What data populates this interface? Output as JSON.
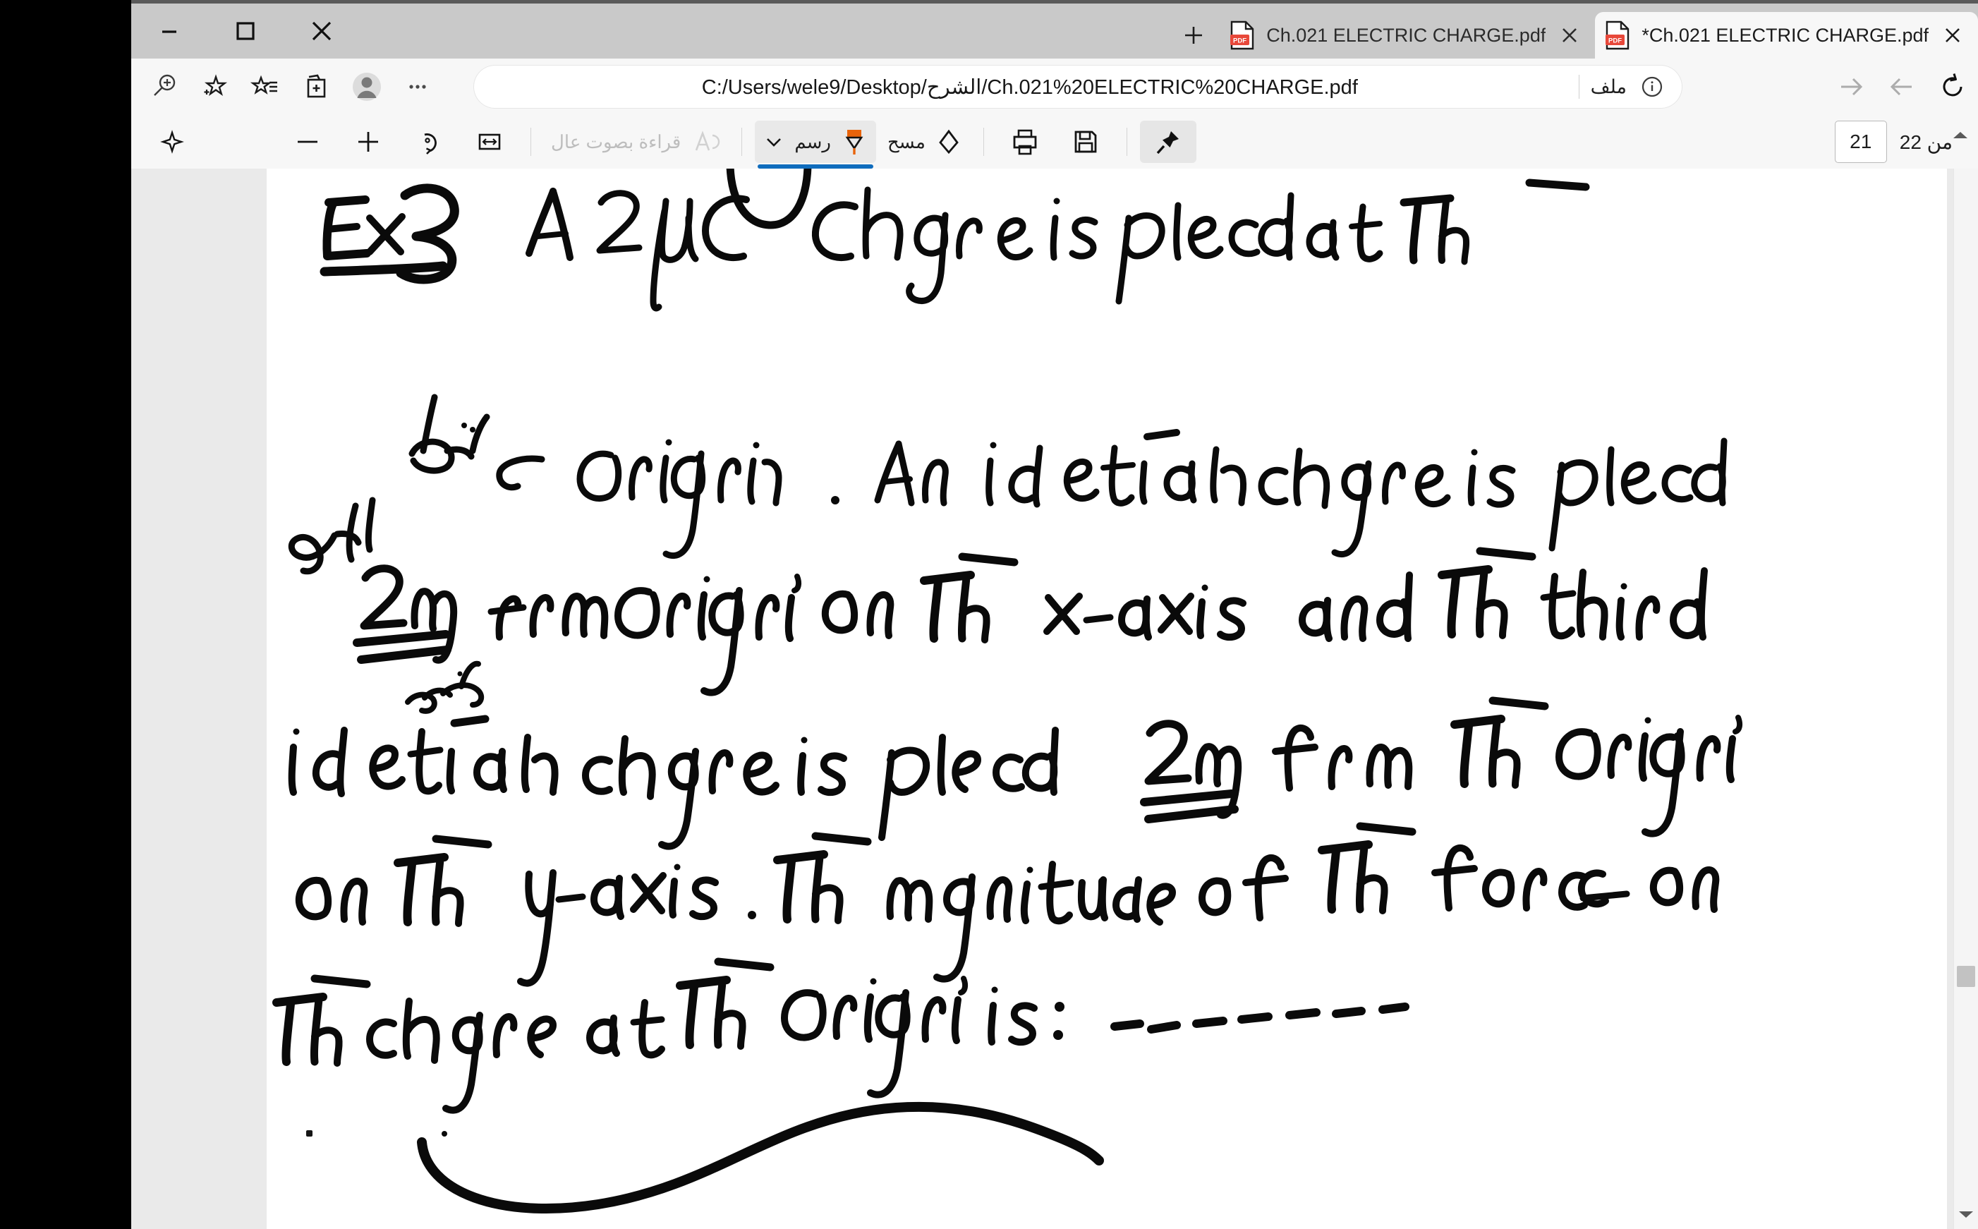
{
  "window": {
    "controls": [
      {
        "name": "close",
        "glyph": "close-icon"
      },
      {
        "name": "maximize",
        "glyph": "maximize-icon"
      },
      {
        "name": "minimize",
        "glyph": "minimize-icon"
      }
    ]
  },
  "tabs": {
    "new_tab_label": "+",
    "items": [
      {
        "title": "*Ch.021 ELECTRIC CHARGE.pdf",
        "active": true,
        "icon": "pdf-icon",
        "close": "×"
      },
      {
        "title": "Ch.021 ELECTRIC CHARGE.pdf",
        "active": false,
        "icon": "pdf-icon",
        "close": "×"
      }
    ]
  },
  "navbar": {
    "left_icons": [
      {
        "name": "settings-more-icon",
        "glyph": "•••"
      },
      {
        "name": "profile-avatar-icon",
        "glyph": "person"
      },
      {
        "name": "collections-icon",
        "glyph": "collections"
      },
      {
        "name": "favorites-list-icon",
        "glyph": "favorites"
      },
      {
        "name": "add-favorite-icon",
        "glyph": "star-plus"
      },
      {
        "name": "zoom-search-icon",
        "glyph": "magnifier-plus"
      }
    ],
    "right_icons": [
      {
        "name": "refresh-icon",
        "glyph": "refresh"
      },
      {
        "name": "back-icon",
        "glyph": "arrow-left",
        "disabled": true
      },
      {
        "name": "forward-icon",
        "glyph": "arrow-right",
        "disabled": true
      }
    ],
    "address": {
      "url": "C:/Users/wele9/Desktop/الشرح/Ch.021%20ELECTRIC%20CHARGE.pdf",
      "file_label": "ملف",
      "info_icon": "info-icon"
    }
  },
  "pdf_toolbar": {
    "pin_label": "",
    "pin_icon": "pin-icon",
    "save_icon": "save-icon",
    "print_icon": "print-icon",
    "erase_label": "مسح",
    "erase_icon": "eraser-icon",
    "draw_label": "رسم",
    "draw_icon": "pen-icon",
    "draw_chevron": "chevron-down-icon",
    "draw_active": true,
    "read_aloud_label": "قراءة بصوت عال",
    "read_aloud_icon": "read-aloud-icon",
    "read_aloud_disabled": true,
    "fit_width_icon": "fit-to-width-icon",
    "rotate_icon": "rotate-icon",
    "zoom_in_icon": "zoom-in-icon",
    "zoom_out_icon": "zoom-out-icon",
    "copilot_icon": "sparkle-icon",
    "page_current": "21",
    "page_total_label": "من 22"
  },
  "document": {
    "handwriting_lines": [
      {
        "id": "l1",
        "text": "Ex 3",
        "underlined": true
      },
      {
        "id": "l2",
        "text": "A 2 μC charge is placed at The"
      },
      {
        "id": "l3_arabic",
        "text": "نقطة"
      },
      {
        "id": "l3",
        "text": "origin . An identical charge is placed"
      },
      {
        "id": "l4_arabic",
        "text": "الاصل"
      },
      {
        "id": "l5",
        "text": "2m from origin on The x-axis and The third"
      },
      {
        "id": "l5_arabic",
        "text": "متساوية"
      },
      {
        "id": "l6",
        "text": "identical charge is placed 2m From The origin"
      },
      {
        "id": "l7",
        "text": "on The y-axis . The magnitude of The force on"
      },
      {
        "id": "l8",
        "text": "The charge at The origin is: - - - - - - -"
      }
    ],
    "annotations": {
      "answer_blank_dashes": 7,
      "wave_underline": "s-curve",
      "double_underline_targets": [
        "2m",
        "2m"
      ]
    }
  },
  "scrollbar": {
    "up_arrow": "scroll-up-arrow-icon",
    "down_arrow": "scroll-down-arrow-icon",
    "thumb": "scrollbar-thumb"
  },
  "colors": {
    "titlebar": "#c9c9c9",
    "toolbar": "#f7f7f7",
    "accent_blue": "#0f6cbd",
    "pen_orange": "#e8630a",
    "pdf_red": "#e8483a",
    "viewer_bg": "#eaeaea"
  }
}
